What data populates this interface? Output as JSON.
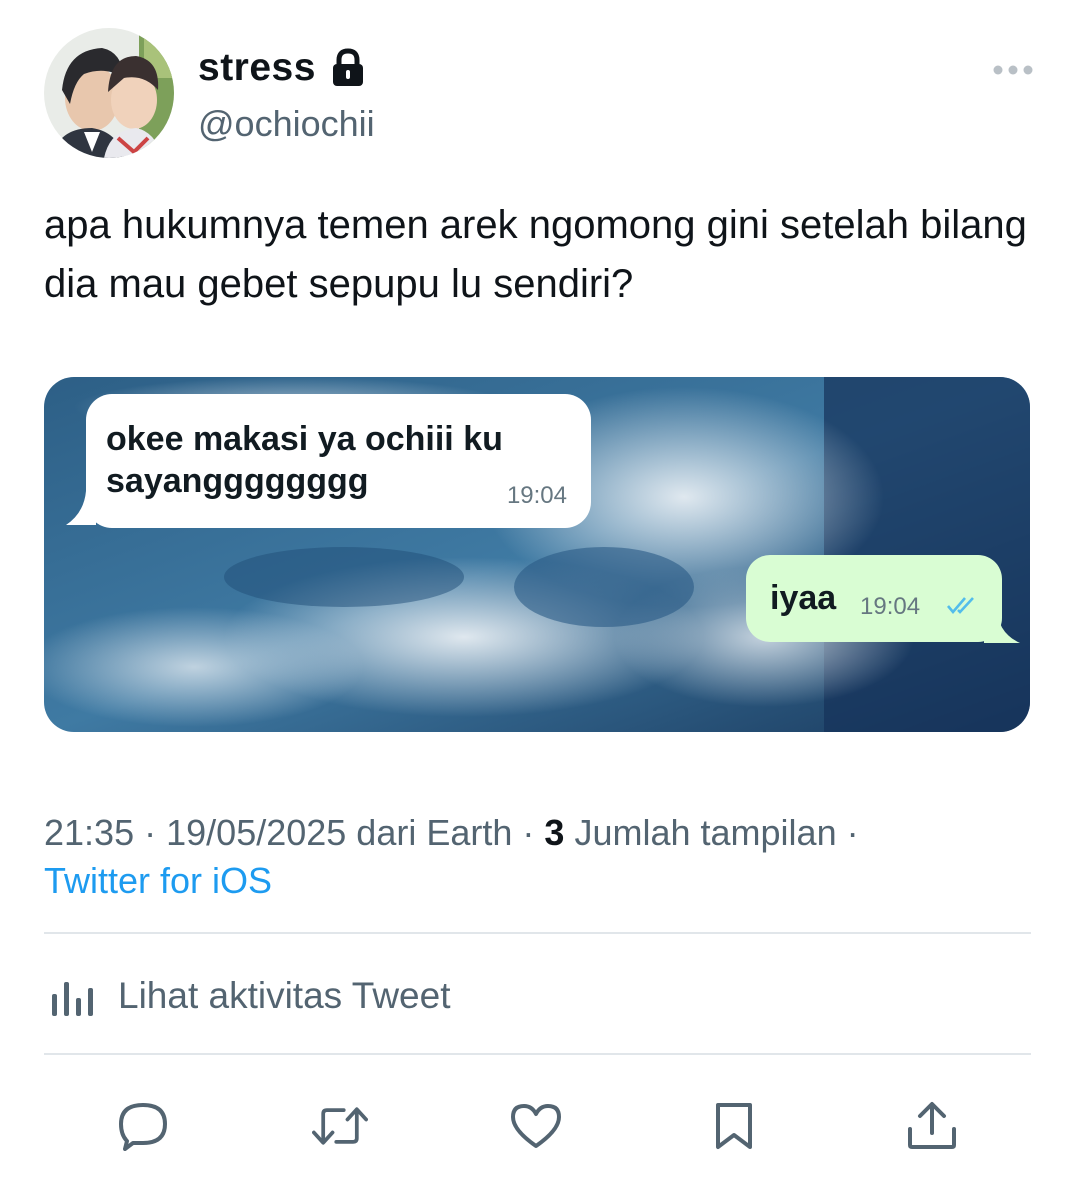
{
  "author": {
    "display_name": "stress",
    "handle": "@ochiochii",
    "avatar_icon": "profile-photo",
    "protected_icon": "lock-icon"
  },
  "header": {
    "more_icon": "more-horizontal-icon"
  },
  "tweet": {
    "text": "apa hukumnya temen arek ngomong gini setelah bilang dia mau gebet sepupu lu sendiri?"
  },
  "media": {
    "incoming_message": {
      "text": "okee makasi ya ochiii ku sayangggggggg",
      "time": "19:04"
    },
    "outgoing_message": {
      "text": "iyaa",
      "time": "19:04",
      "status_icon": "double-check-icon"
    }
  },
  "meta": {
    "time": "21:35",
    "separator": "·",
    "date_location": "19/05/2025 dari Earth",
    "views_count": "3",
    "views_label": "Jumlah tampilan",
    "source": "Twitter for iOS"
  },
  "activity": {
    "label": "Lihat aktivitas Tweet",
    "icon": "analytics-icon"
  },
  "actions": [
    {
      "name": "reply",
      "icon": "reply-icon"
    },
    {
      "name": "retweet",
      "icon": "retweet-icon"
    },
    {
      "name": "like",
      "icon": "heart-icon"
    },
    {
      "name": "bookmark",
      "icon": "bookmark-icon"
    },
    {
      "name": "share",
      "icon": "share-icon"
    }
  ],
  "colors": {
    "text": "#0f1419",
    "secondary": "#536471",
    "link": "#1d9bf0",
    "divider": "#e1e6ea",
    "incoming_bubble": "#ffffff",
    "outgoing_bubble": "#d9fdd3",
    "read_tick": "#53bdeb"
  }
}
